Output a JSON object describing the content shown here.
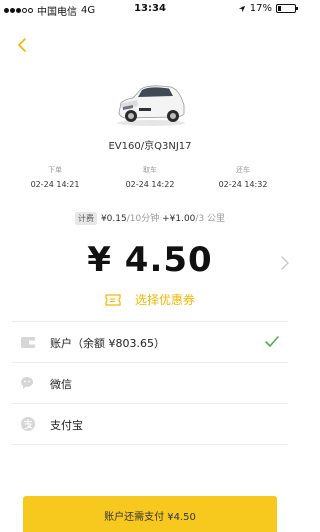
{
  "status_bar": {
    "carrier": "中国电信",
    "network": "4G",
    "time": "13:34",
    "battery_text": "17%",
    "battery_level": 0.17
  },
  "car": {
    "name": "EV160/京Q3NJ17"
  },
  "timeline": [
    {
      "label": "下单",
      "time": "02-24 14:21"
    },
    {
      "label": "取车",
      "time": "02-24 14:22"
    },
    {
      "label": "还车",
      "time": "02-24 14:32"
    }
  ],
  "billing": {
    "tag": "计费",
    "time_price": "¥0.15",
    "time_unit": "10分钟",
    "plus": "+",
    "distance_price": "¥1.00",
    "distance_unit": "3 公里"
  },
  "total": {
    "amount": "¥ 4.50"
  },
  "coupon": {
    "label": "选择优惠券"
  },
  "payment_methods": [
    {
      "label": "账户（余额 ¥803.65）",
      "icon": "wallet-icon",
      "selected": true
    },
    {
      "label": "微信",
      "icon": "wechat-icon",
      "selected": false
    },
    {
      "label": "支付宝",
      "icon": "alipay-icon",
      "selected": false
    }
  ],
  "pay_button": {
    "label": "账户还需支付 ¥4.50"
  },
  "colors": {
    "accent": "#f5b800",
    "pay_button": "#f7c81d",
    "check": "#4caf50",
    "icon_gray": "#d6d6d6"
  }
}
